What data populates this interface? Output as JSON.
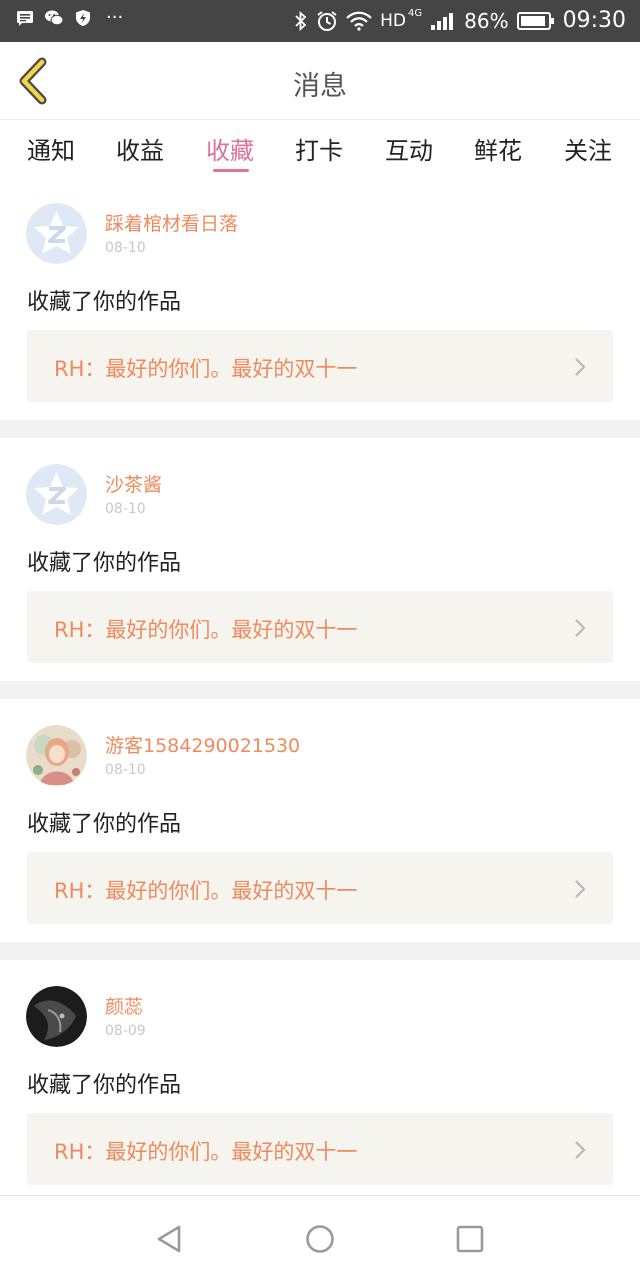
{
  "status_bar": {
    "dots": "···",
    "network": "HD",
    "network_gen": "4G",
    "battery": "86%",
    "time": "09:30"
  },
  "header": {
    "title": "消息",
    "back_icon": "chevron-left-icon"
  },
  "tabs": [
    {
      "label": "通知",
      "active": false
    },
    {
      "label": "收益",
      "active": false
    },
    {
      "label": "收藏",
      "active": true
    },
    {
      "label": "打卡",
      "active": false
    },
    {
      "label": "互动",
      "active": false
    },
    {
      "label": "鲜花",
      "active": false
    },
    {
      "label": "关注",
      "active": false
    }
  ],
  "items": [
    {
      "name": "踩着棺材看日落",
      "date": "08-10",
      "action": "收藏了你的作品",
      "work": "RH：最好的你们。最好的双十一",
      "avatar": "default-avatar-icon"
    },
    {
      "name": "沙茶酱",
      "date": "08-10",
      "action": "收藏了你的作品",
      "work": "RH：最好的你们。最好的双十一",
      "avatar": "default-avatar-icon"
    },
    {
      "name": "游客1584290021530",
      "date": "08-10",
      "action": "收藏了你的作品",
      "work": "RH：最好的你们。最好的双十一",
      "avatar": "anime-girl-avatar"
    },
    {
      "name": "颜蕊",
      "date": "08-09",
      "action": "收藏了你的作品",
      "work": "RH：最好的你们。最好的双十一",
      "avatar": "dark-portrait-avatar"
    }
  ],
  "colors": {
    "accent_pink": "#e0719b",
    "name_orange": "#f08a5d",
    "status_bar": "#454545",
    "work_bg": "#f5f4ef"
  },
  "navbar": {
    "icons": [
      "back-triangle-icon",
      "home-circle-icon",
      "recents-square-icon"
    ]
  }
}
